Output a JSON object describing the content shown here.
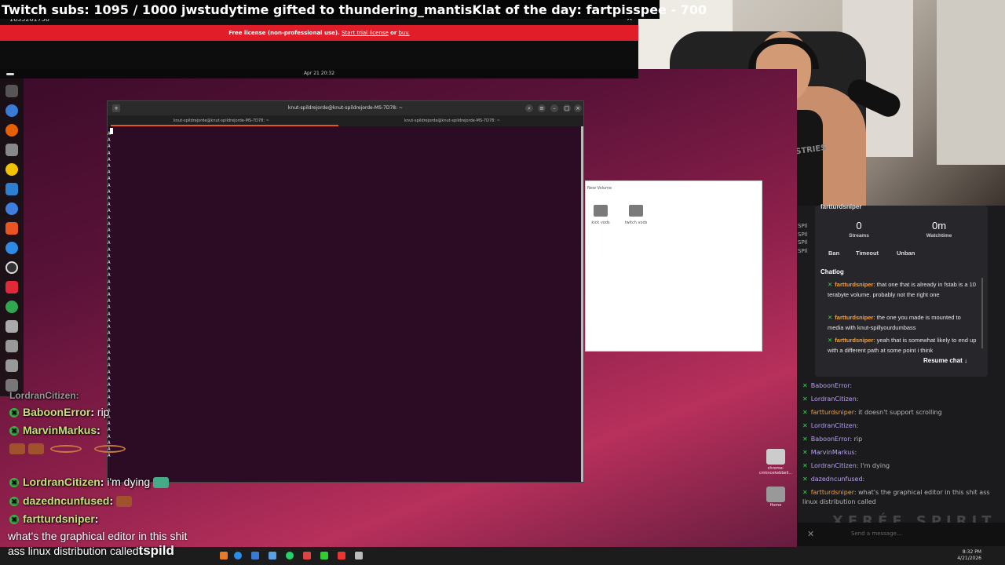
{
  "alert": "Twitch subs: 1095 / 1000    jwstudytime gifted to thundering_mantisKlat of the day: fartpisspee - 700",
  "viewer": {
    "session_id": "1635261756",
    "license_text": "Free license (non-professional use).",
    "trial_link": "Start trial license",
    "or": "or",
    "buy_link": "buy."
  },
  "desktop": {
    "clock": "Apr 21 20:32",
    "terminal": {
      "title": "knut-spildrejorde@knut-spildrejorde-MS-7D78: ~",
      "tab1": "knut-spildrejorde@knut-spildrejorde-MS-7D78: ~",
      "tab2": "knut-spildrejorde@knut-spildrejorde-MS-7D78: ~",
      "output": "A\nA\nA\nA\nA\nA\nA\nA\nA\nA\nA\nA\nA\nA\nA\nA\nA\nA\nA\nA\nA\nA\nA\nA\nA\nA\nA\nA\nA\nA\nA\nA\nA\nA\nA\nA\nA\nA\nA\nA\nA\nA\nA\nA\nA\nA\nA\nA\nA\nA\nA"
    },
    "files": {
      "title": "New Volume",
      "folders": [
        "kick vods",
        "twitch vods"
      ]
    },
    "icons": [
      {
        "label": "chrome-cmkncekebbeli..."
      },
      {
        "label": "Home"
      }
    ]
  },
  "taskbar": {
    "time": "8:32 PM",
    "date": "4/21/2026"
  },
  "webcam": {
    "shirt_text": "GASP INDUSTRIES"
  },
  "mod_card": {
    "username": "fartturdsniper",
    "stats": [
      {
        "value": "0",
        "label": "Streams"
      },
      {
        "value": "0m",
        "label": "Watchtime"
      }
    ],
    "buttons": [
      "Ban",
      "Timeout",
      "Unban"
    ],
    "chatlog_title": "Chatlog",
    "chatlog": [
      {
        "user": "fartturdsniper",
        "text": "that one that is already in fstab is a 10 terabyte volume. probably not the right one"
      },
      {
        "user": "fartturdsniper",
        "text": "the one you made is mounted to media with knut-spillyourdumbass"
      },
      {
        "user": "fartturdsniper",
        "text": "yeah that is somewhat likely to end up with a different path at some point i think"
      }
    ],
    "resume": "Resume chat ↓"
  },
  "side_chat": [
    {
      "user": "BaboonError",
      "text": ""
    },
    {
      "user": "LordranCitizen",
      "text": ""
    },
    {
      "user": "fartturdsniper",
      "text": "it doesn't support scrolling"
    },
    {
      "user": "LordranCitizen",
      "text": ""
    },
    {
      "user": "BaboonError",
      "text": "rip"
    },
    {
      "user": "MarvinMarkus",
      "text": ""
    },
    {
      "user": "LordranCitizen",
      "text": "I'm dying"
    },
    {
      "user": "dazedncunfused",
      "text": ""
    },
    {
      "user": "fartturdsniper",
      "text": "what's the graphical editor in this shit ass"
    },
    {
      "user": "",
      "text": "linux distribution called"
    }
  ],
  "side_chat_prefix": "SPIl",
  "send_placeholder": "Send a message...",
  "brand": "XERÉE SPIRIT",
  "overlay_chat": {
    "top_partial": "LordranCitizen:",
    "messages": [
      {
        "user": "BaboonError",
        "text": "rip"
      },
      {
        "user": "MarvinMarkus",
        "text": ""
      },
      {
        "user": "LordranCitizen",
        "text": "i'm dying"
      },
      {
        "user": "dazedncunfused",
        "text": ""
      },
      {
        "user": "fartturdsniper",
        "text": ""
      }
    ],
    "line1": "what's the graphical editor in this shit",
    "line2a": "ass linux distribution called",
    "line2b": "tspild"
  }
}
